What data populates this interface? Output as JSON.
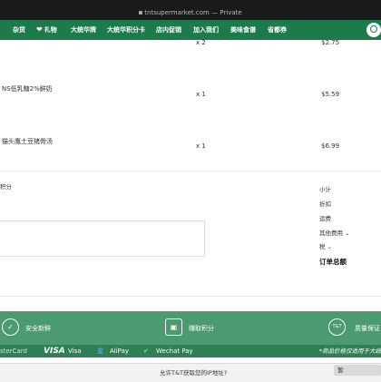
{
  "browser": {
    "url": "tntsupermarket.com",
    "mode": "— Private"
  },
  "nav": {
    "items": [
      "杂货",
      "礼物",
      "大统华牌",
      "大统华积分卡",
      "店内促销",
      "加入我们",
      "美味食谱",
      "省都券"
    ]
  },
  "cart": {
    "rows": [
      {
        "name": "",
        "qty": "x 2",
        "price": "$2.75"
      },
      {
        "name": "NS低乳糖2%鲜奶",
        "qty": "x 1",
        "price": "$5.59"
      },
      {
        "name": "猫头鹰土豆猪骨汤",
        "qty": "x 1",
        "price": "$6.99"
      }
    ]
  },
  "points_fragment": "积分",
  "summary": {
    "subtotal": "小计",
    "discount": "折扣",
    "shipping": "运费",
    "other_fees": "其他费用",
    "tax": "税",
    "total": "订单总额"
  },
  "features": [
    {
      "icon": "shield-check-icon",
      "label": "安全新鲜"
    },
    {
      "icon": "gift-points-icon",
      "label": "赚取积分"
    },
    {
      "icon": "tnt-logo-icon",
      "icon_text": "T&T",
      "label": "质量保证"
    }
  ],
  "payments": {
    "mastercard": "sterCard",
    "visa_logo": "VISA",
    "visa": "Visa",
    "alipay": "AliPay",
    "wechat": "Wechat Pay"
  },
  "price_note": "*商品价格仅适用于大统",
  "location_prompt": {
    "text": "允许T&T获取您的IP地址?",
    "deny": "暂"
  },
  "colors": {
    "nav_green": "#1d7a4b",
    "band_green": "#4c9a6f",
    "pay_green": "#2f7f55"
  }
}
